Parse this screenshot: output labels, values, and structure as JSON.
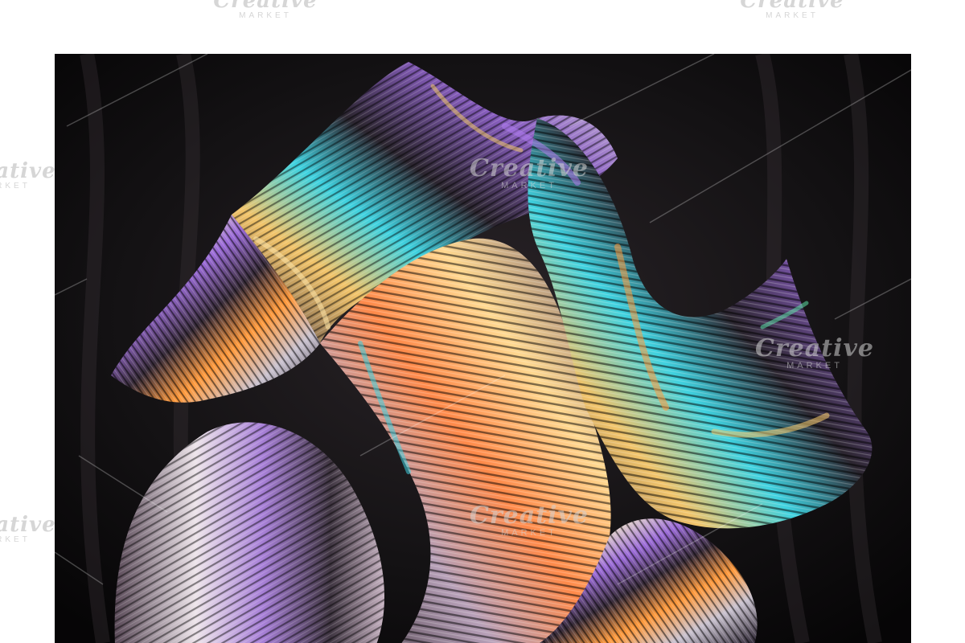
{
  "watermark": {
    "brand": "Creative",
    "subtitle": "MARKET"
  },
  "colors": {
    "background": "#ffffff",
    "photo_background": "#0b0a0b",
    "iridescent_violet": "#9b6bd8",
    "iridescent_orange": "#ff9a3c",
    "iridescent_cyan": "#3fd2e0",
    "chrome_silver": "#c9c2cf"
  }
}
